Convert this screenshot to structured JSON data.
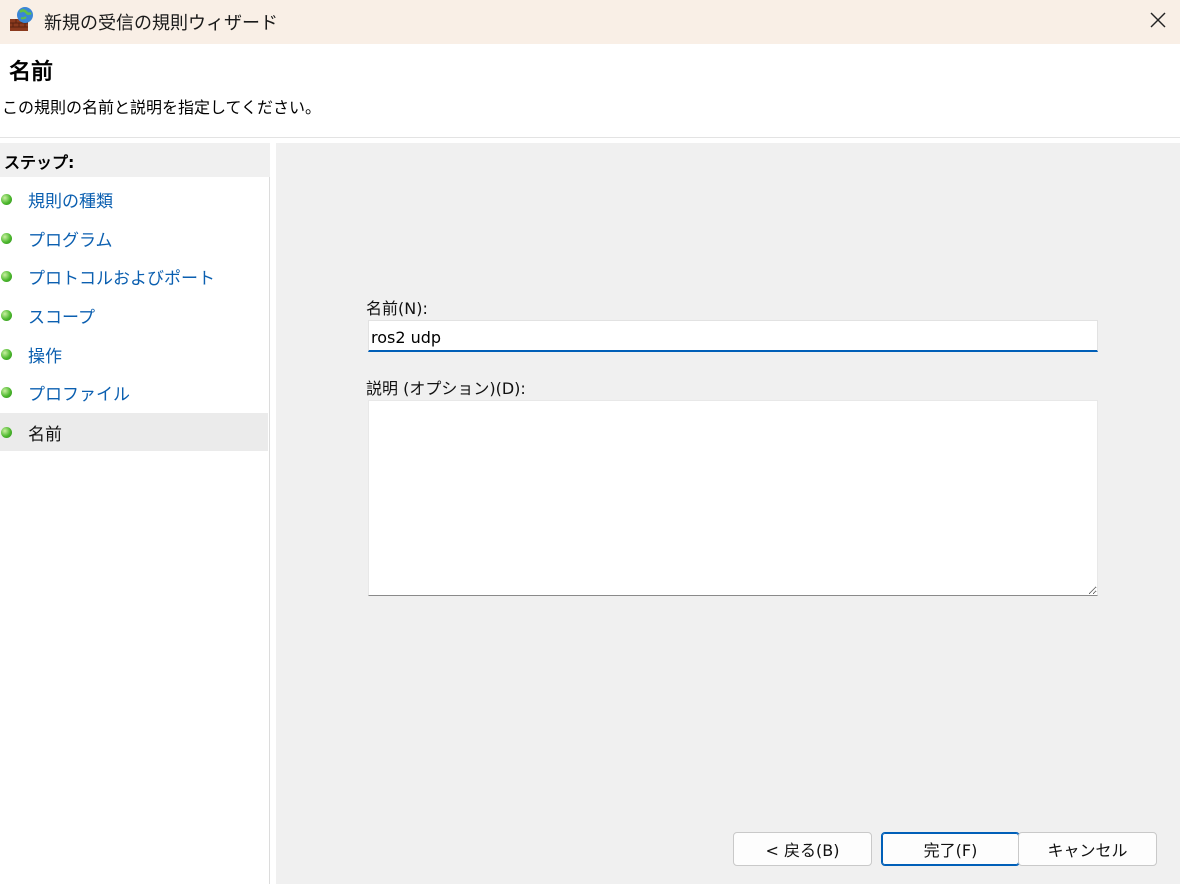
{
  "window": {
    "title": "新規の受信の規則ウィザード",
    "icon": "firewall-icon",
    "close_glyph": "✕"
  },
  "header": {
    "title": "名前",
    "subtitle": "この規則の名前と説明を指定してください。"
  },
  "steps": {
    "heading": "ステップ:",
    "items": [
      {
        "label": "規則の種類",
        "active": false
      },
      {
        "label": "プログラム",
        "active": false
      },
      {
        "label": "プロトコルおよびポート",
        "active": false
      },
      {
        "label": "スコープ",
        "active": false
      },
      {
        "label": "操作",
        "active": false
      },
      {
        "label": "プロファイル",
        "active": false
      },
      {
        "label": "名前",
        "active": true
      }
    ]
  },
  "form": {
    "name_label": "名前(N):",
    "name_value": "ros2 udp",
    "description_label": "説明 (オプション)(D):",
    "description_value": ""
  },
  "buttons": {
    "back": "< 戻る(B)",
    "finish": "完了(F)",
    "cancel": "キャンセル"
  },
  "colors": {
    "titlebar": "#f9efe6",
    "link": "#0b5fb0",
    "accent": "#005fb8",
    "panel": "#f0f0f0"
  }
}
